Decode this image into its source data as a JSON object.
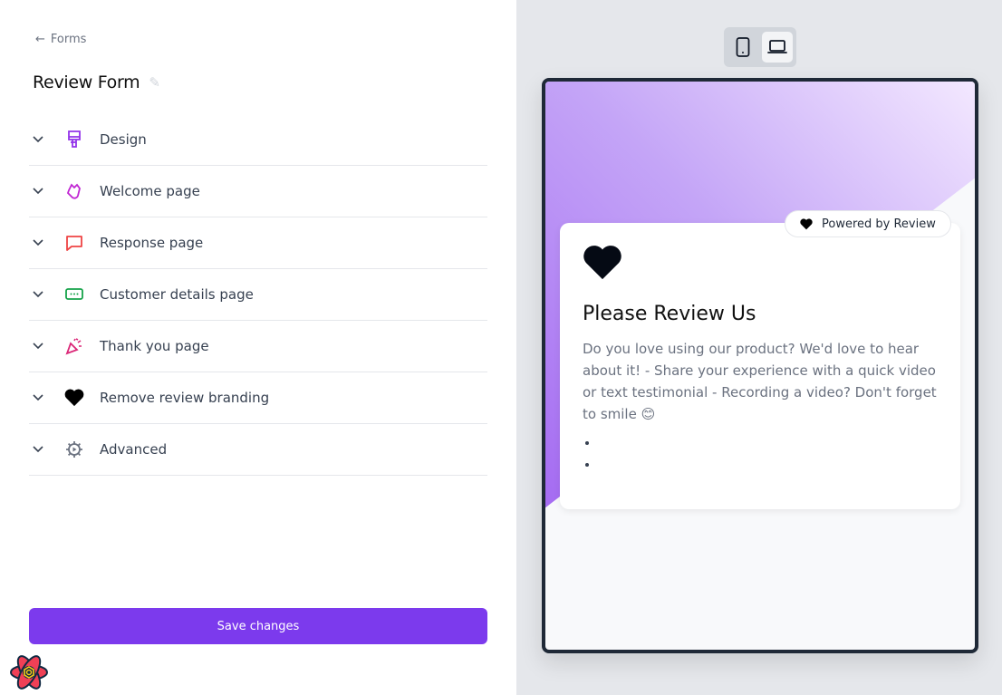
{
  "nav": {
    "back_label": "Forms"
  },
  "form": {
    "title": "Review Form"
  },
  "sections": [
    {
      "label": "Design",
      "icon": "paintbrush-icon",
      "color": "#9333ea"
    },
    {
      "label": "Welcome page",
      "icon": "waving-hand-icon",
      "color": "#c026d3"
    },
    {
      "label": "Response page",
      "icon": "chat-bubble-icon",
      "color": "#ef4444"
    },
    {
      "label": "Customer details page",
      "icon": "input-field-icon",
      "color": "#16a34a"
    },
    {
      "label": "Thank you page",
      "icon": "party-popper-icon",
      "color": "#db2777"
    },
    {
      "label": "Remove review branding",
      "icon": "heart-icon",
      "color": "#000000"
    },
    {
      "label": "Advanced",
      "icon": "gear-icon",
      "color": "#6b7280"
    }
  ],
  "save_label": "Save changes",
  "preview": {
    "powered_label": "Powered by Review",
    "title": "Please Review Us",
    "description": "Do you love using our product? We'd love to hear about it! - Share your experience with a quick video or text testimonial - Recording a video? Don't forget to smile 😊",
    "bullets": [
      "",
      ""
    ]
  },
  "colors": {
    "accent": "#7c3aed"
  }
}
